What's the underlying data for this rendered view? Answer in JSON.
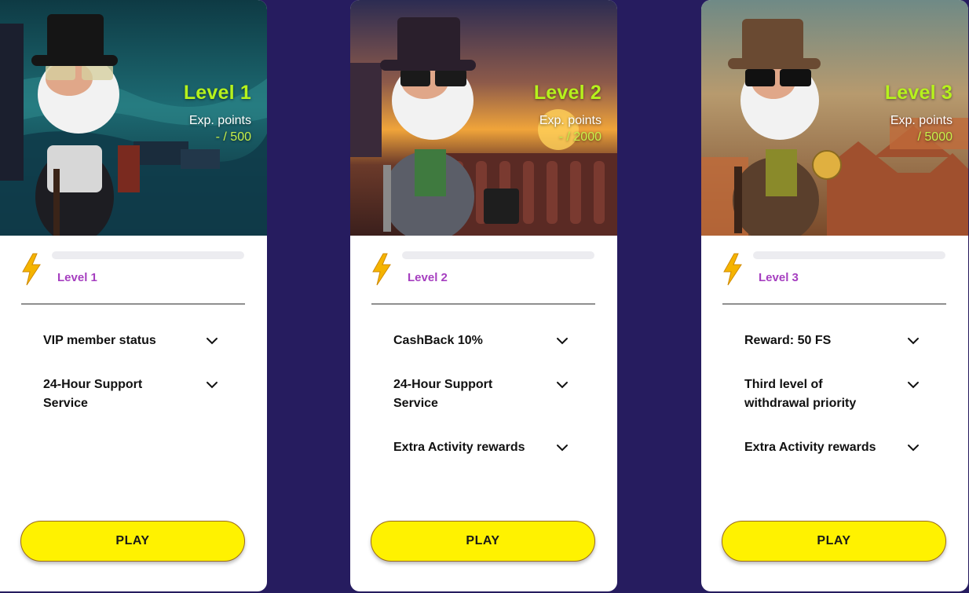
{
  "cards": [
    {
      "hero_level": "Level 1",
      "exp_label": "Exp. points",
      "exp_value": "- / 500",
      "progress_fraction": 0,
      "level_label": "Level 1",
      "benefits": [
        "VIP member status",
        "24-Hour Support Service"
      ],
      "play_label": "PLAY",
      "theme": "stormy-sea"
    },
    {
      "hero_level": "Level 2",
      "exp_label": "Exp. points",
      "exp_value": "- / 2000",
      "progress_fraction": 0,
      "level_label": "Level 2",
      "benefits": [
        "CashBack 10%",
        "24-Hour Support Service",
        "Extra Activity rewards"
      ],
      "play_label": "PLAY",
      "theme": "sunset-balcony"
    },
    {
      "hero_level": "Level 3",
      "exp_label": "Exp. points",
      "exp_value": "/ 5000",
      "progress_fraction": 0,
      "level_label": "Level 3",
      "benefits": [
        "Reward: 50 FS",
        "Third level of withdrawal priority",
        "Extra Activity rewards"
      ],
      "play_label": "PLAY",
      "theme": "rooftops"
    }
  ],
  "colors": {
    "page_background": "#261c5f",
    "accent_green": "#b6f21c",
    "level_purple": "#a63fc0",
    "play_yellow": "#fff200"
  },
  "icons": {
    "progress": "lightning-bolt-icon",
    "expand": "chevron-down-icon"
  }
}
